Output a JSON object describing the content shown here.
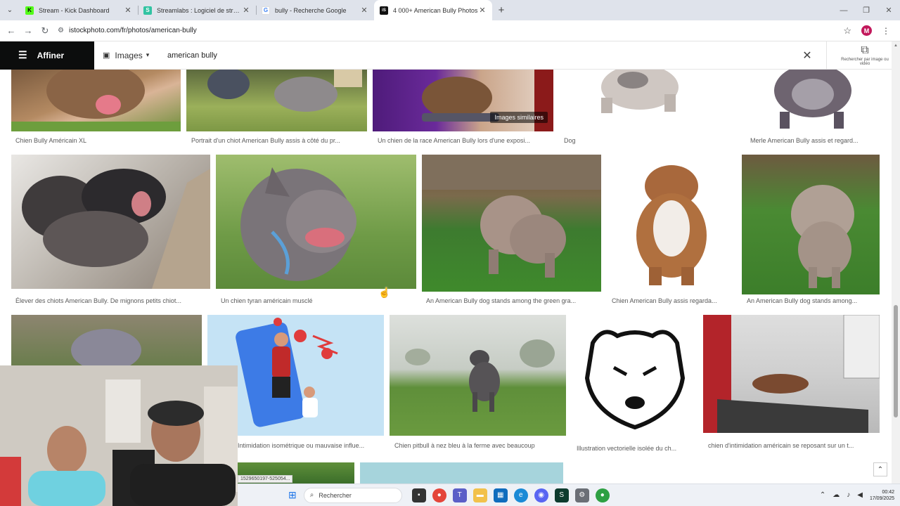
{
  "browser": {
    "tabs": [
      {
        "title": "Stream - Kick Dashboard",
        "fav_color": "#53fc18",
        "fav_text": "K",
        "active": false
      },
      {
        "title": "Streamlabs : Logiciel de stream",
        "fav_color": "#31c3a2",
        "fav_text": "S",
        "active": false
      },
      {
        "title": "bully - Recherche Google",
        "fav_color": "#4285f4",
        "fav_text": "G",
        "active": false
      },
      {
        "title": "4 000+ American Bully Photos",
        "fav_color": "#111111",
        "fav_text": "iS",
        "active": true
      }
    ],
    "url": "istockphoto.com/fr/photos/american-bully",
    "profile_initial": "M",
    "accent": "#c2185b"
  },
  "searchbar": {
    "refine_label": "Affiner",
    "media_type": "Images",
    "query": "american bully",
    "visual_search_label": "Rechercher par image ou vidéo"
  },
  "results": {
    "similar_badge": "Images similaires",
    "rows": [
      [
        {
          "caption": "Chien Bully Américain XL",
          "icon": "photo-dog-smiling"
        },
        {
          "caption": "Portrait d'un chiot American Bully assis à côté du pr...",
          "icon": "photo-puppies-grass"
        },
        {
          "caption": "Un chien de la race American Bully lors d'une exposi...",
          "icon": "photo-dog-show"
        },
        {
          "caption": "Dog",
          "icon": "photo-dog-white-bg"
        },
        {
          "caption": "Merle American Bully assis et regard...",
          "icon": "photo-merle-dog"
        }
      ],
      [
        {
          "caption": "Élever des chiots American Bully. De mignons petits chiot...",
          "icon": "photo-puppies-sleeping"
        },
        {
          "caption": "Un chien tyran américain musclé",
          "icon": "photo-dog-profile"
        },
        {
          "caption": "An American Bully dog stands among the green gra...",
          "icon": "photo-dog-garden"
        },
        {
          "caption": "Chien American Bully assis regarda...",
          "icon": "photo-dog-sitting"
        },
        {
          "caption": "An American Bully dog stands among...",
          "icon": "photo-dog-grass"
        }
      ],
      [
        {
          "caption": "",
          "icon": "photo-dog-outdoor"
        },
        {
          "caption": "Intimidation isométrique ou mauvaise influe...",
          "icon": "illustration-bullying"
        },
        {
          "caption": "Chien pitbull à nez bleu à la ferme avec beaucoup",
          "icon": "photo-pitbull-field"
        },
        {
          "caption": "Illustration vectorielle isolée du ch...",
          "icon": "illustration-dog-head"
        },
        {
          "caption": "chien d'intimidation américain se reposant sur un t...",
          "icon": "photo-dog-treadmill"
        }
      ]
    ],
    "hover_link": "1529650197-525054..."
  },
  "taskbar": {
    "search_placeholder": "Rechercher",
    "time": "00:42",
    "date": "17/09/2025"
  }
}
